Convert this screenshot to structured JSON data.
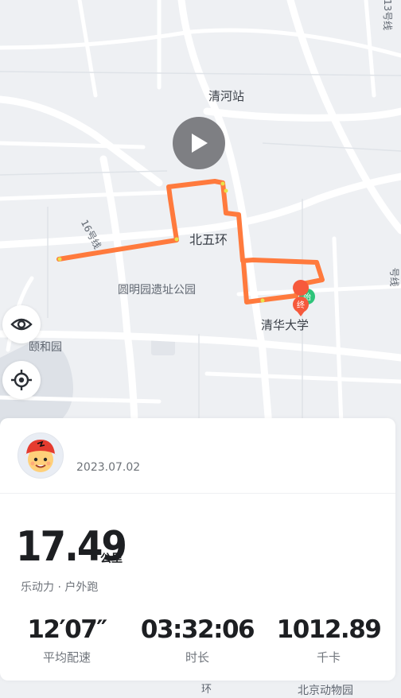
{
  "map": {
    "labels": {
      "qinghe_station": "清河站",
      "north_fifth_ring": "北五环",
      "yuanmingyuan": "圆明园遗址公园",
      "tsinghua": "清华大学",
      "summer_palace": "颐和园",
      "beijing_zoo": "北京动物园",
      "line_16": "16号线",
      "line_13": "13号线",
      "line_4": "号线",
      "ring_fragment": "环"
    },
    "end_marker_label": "终",
    "start_marker_label": "始",
    "route_color": "#ff7a3d"
  },
  "controls": {
    "play_icon": "play-icon",
    "visibility_icon": "eye-icon",
    "locate_icon": "crosshair-icon"
  },
  "workout": {
    "date": "2023.07.02",
    "distance": "17.49",
    "distance_unit": "公里",
    "source_type": "乐动力 · 户外跑",
    "stats": [
      {
        "value": "12′07″",
        "label": "平均配速"
      },
      {
        "value": "03:32:06",
        "label": "时长"
      },
      {
        "value": "1012.89",
        "label": "千卡"
      }
    ]
  }
}
